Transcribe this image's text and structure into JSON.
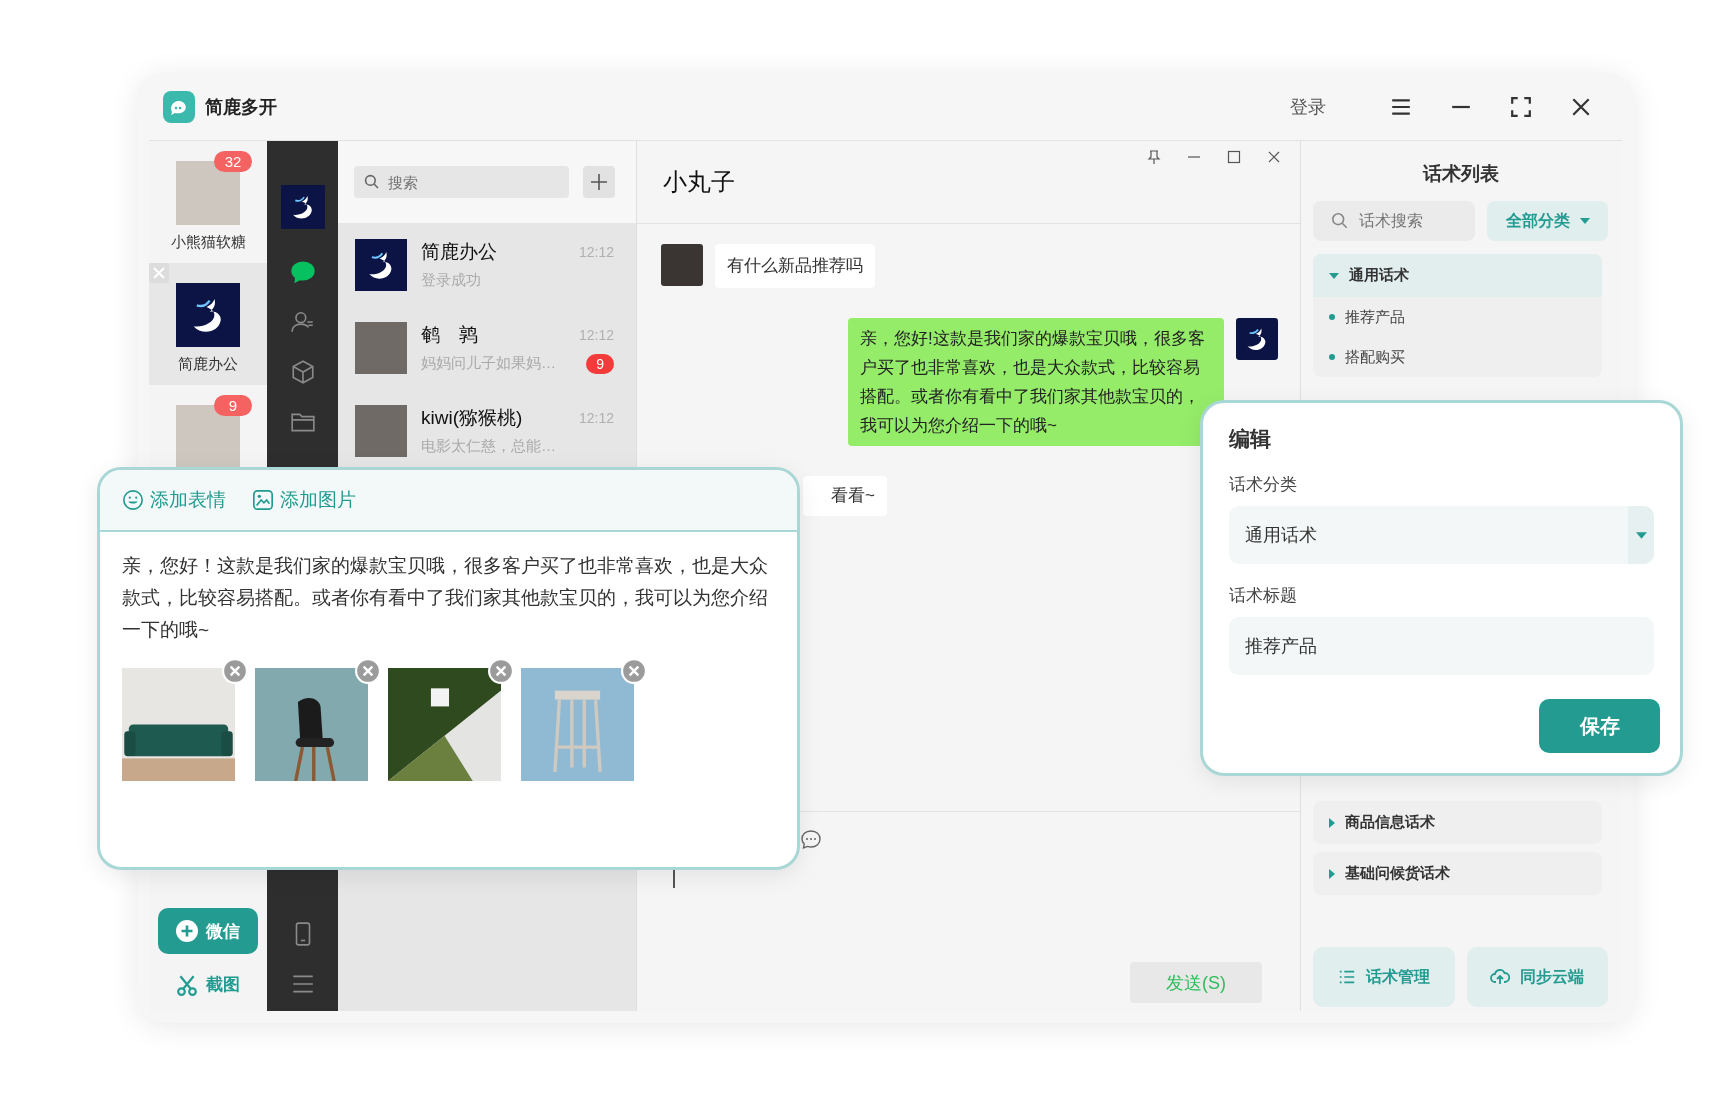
{
  "app": {
    "title": "简鹿多开",
    "login": "登录"
  },
  "accounts": [
    {
      "name": "小熊猫软糖",
      "badge": "32",
      "selected": false,
      "kind": "photo"
    },
    {
      "name": "简鹿办公",
      "selected": true,
      "kind": "logo"
    },
    {
      "badge": "9",
      "selected": false,
      "kind": "photo"
    }
  ],
  "account_actions": [
    {
      "label": "微信",
      "kind": "add"
    },
    {
      "label": "截图",
      "kind": "screenshot"
    }
  ],
  "nav": {
    "items": [
      {
        "selected": true
      },
      {
        "selected": false
      },
      {
        "selected": false
      },
      {
        "selected": false
      }
    ]
  },
  "chat_list": {
    "search_placeholder": "搜索",
    "items": [
      {
        "name": "简鹿办公",
        "time": "12:12",
        "preview": "登录成功",
        "kind": "logo"
      },
      {
        "name": "鹌　鹑",
        "time": "12:12",
        "preview": "妈妈问儿子如果妈…",
        "badge": "9",
        "kind": "photo"
      },
      {
        "name": "kiwi(猕猴桃)",
        "time": "12:12",
        "preview": "电影太仁慈，总能…",
        "kind": "photo"
      }
    ]
  },
  "chat": {
    "title": "小丸子",
    "messages": [
      {
        "kind": "incoming",
        "text": "有什么新品推荐吗"
      },
      {
        "kind": "outgoing",
        "text": "亲，您好!这款是我们家的爆款宝贝哦，很多客户买了也非常喜欢，也是大众款式，比较容易搭配。或者你有看中了我们家其他款宝贝的，我可以为您介绍一下的哦~"
      }
    ],
    "peek_message": "看看~",
    "send": "发送(S)"
  },
  "scripts": {
    "title": "话术列表",
    "search_placeholder": "话术搜索",
    "filter": "全部分类",
    "groups": [
      {
        "name": "通用话术",
        "expanded": true,
        "children": [
          {
            "name": "推荐产品"
          },
          {
            "name": "搭配购买"
          }
        ]
      },
      {
        "name": "商品信息话术",
        "expanded": false
      },
      {
        "name": "基础问候货话术",
        "expanded": false
      }
    ],
    "buttons": [
      {
        "label": "话术管理",
        "kind": "manage"
      },
      {
        "label": "同步云端",
        "kind": "sync"
      }
    ]
  },
  "composer": {
    "tools": [
      {
        "label": "添加表情",
        "kind": "emoji"
      },
      {
        "label": "添加图片",
        "kind": "image"
      }
    ],
    "text": "亲，您好！这款是我们家的爆款宝贝哦，很多客户买了也非常喜欢，也是大众款式，比较容易搭配。或者你有看中了我们家其他款宝贝的，我可以为您介绍一下的哦~",
    "images": [
      {
        "kind": "sofa"
      },
      {
        "kind": "chair"
      },
      {
        "kind": "cube"
      },
      {
        "kind": "stool"
      }
    ]
  },
  "editor": {
    "title": "编辑",
    "fields": [
      {
        "label": "话术分类",
        "kind": "select",
        "value": "通用话术"
      },
      {
        "label": "话术标题",
        "kind": "input",
        "value": "推荐产品"
      }
    ],
    "save": "保存"
  }
}
